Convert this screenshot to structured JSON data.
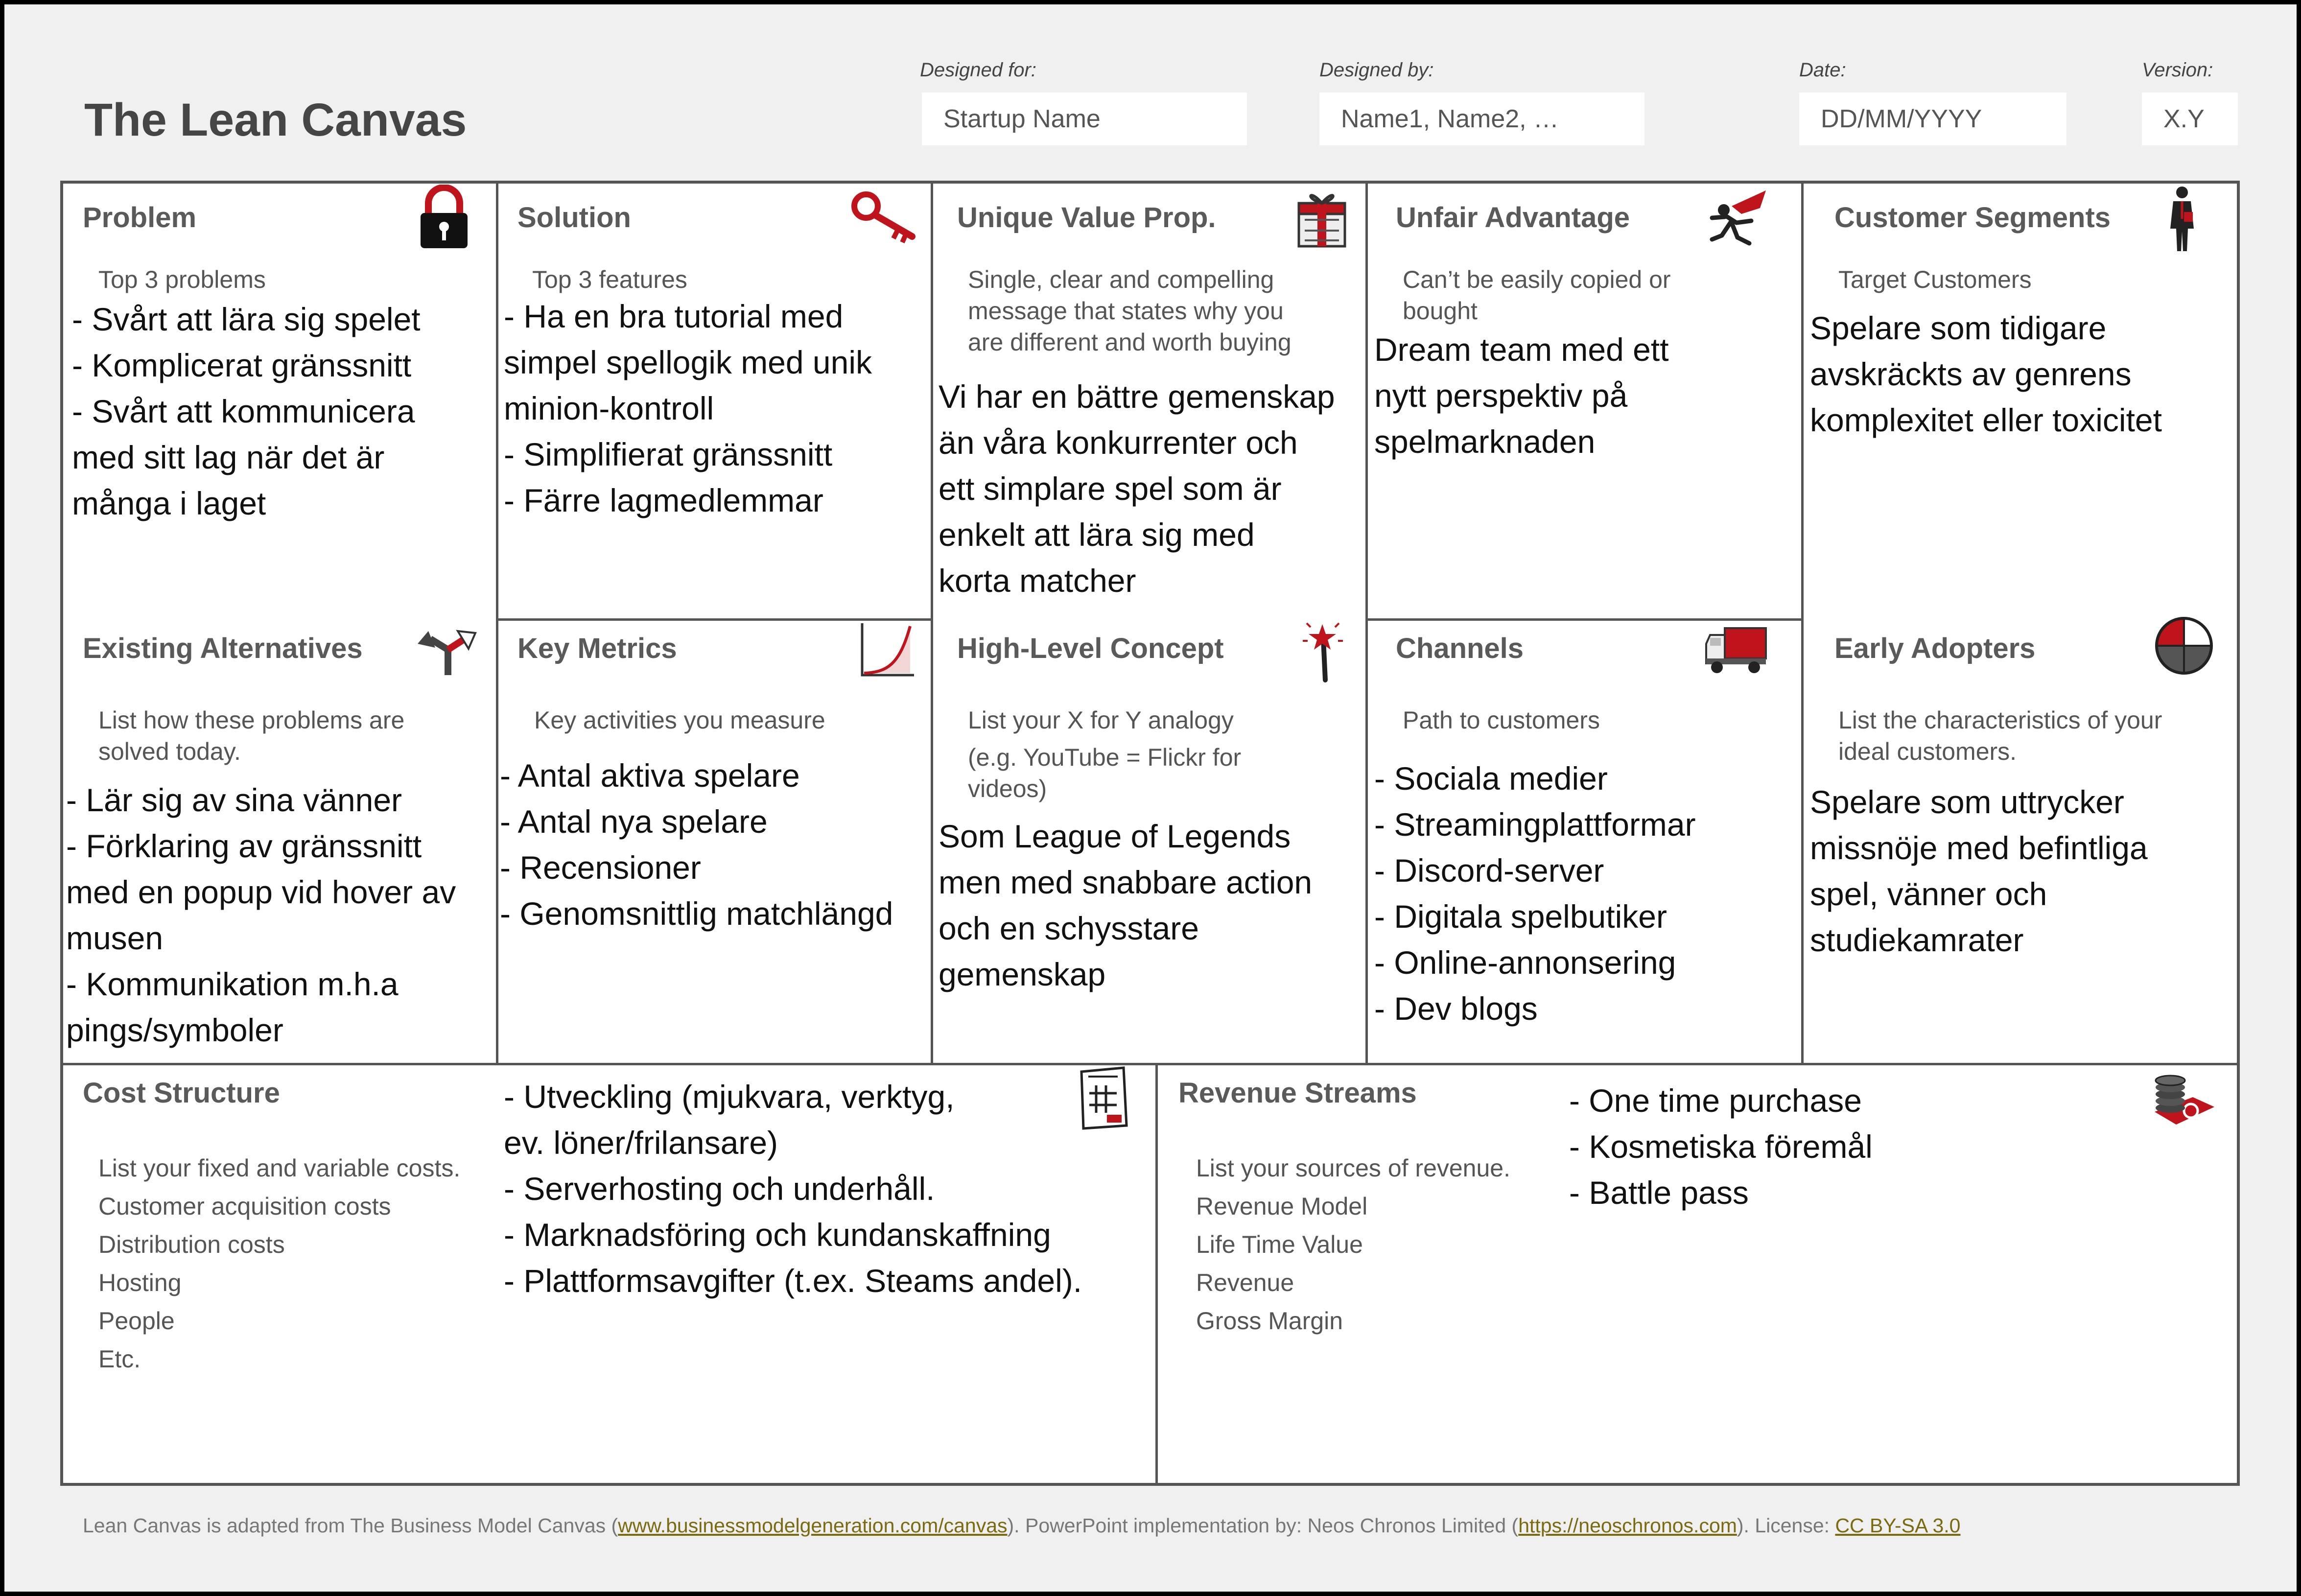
{
  "header": {
    "title": "The Lean Canvas",
    "designed_for_label": "Designed for:",
    "designed_for_value": "Startup Name",
    "designed_by_label": "Designed by:",
    "designed_by_value": "Name1, Name2, …",
    "date_label": "Date:",
    "date_value": "DD/MM/YYYY",
    "version_label": "Version:",
    "version_value": "X.Y"
  },
  "problem": {
    "title": "Problem",
    "icon": "padlock-icon",
    "hint": [
      "Top 3 problems"
    ],
    "lines": [
      "- Svårt att lära sig spelet",
      "- Komplicerat gränssnitt",
      "- Svårt att kommunicera",
      "med sitt lag när det är",
      "många i laget"
    ]
  },
  "solution": {
    "title": "Solution",
    "icon": "key-icon",
    "hint": [
      "Top 3 features"
    ],
    "lines": [
      "- Ha en bra tutorial med",
      "simpel spellogik med unik",
      "minion-kontroll",
      "- Simplifierat gränssnitt",
      "- Färre lagmedlemmar"
    ]
  },
  "uvp": {
    "title": "Unique Value Prop.",
    "icon": "gift-icon",
    "hint": [
      "Single, clear and compelling",
      "message that states why you",
      "are different and worth buying"
    ],
    "lines": [
      "Vi har en bättre gemenskap",
      "än våra konkurrenter och",
      "ett simplare spel som är",
      "enkelt att lära sig med",
      "korta matcher"
    ]
  },
  "unfair": {
    "title": "Unfair Advantage",
    "icon": "superhero-icon",
    "hint": [
      "Can’t be easily copied or",
      "bought"
    ],
    "lines": [
      "Dream team med ett",
      "nytt perspektiv på",
      "spelmarknaden"
    ]
  },
  "segments": {
    "title": "Customer Segments",
    "icon": "person-icon",
    "hint": [
      "Target Customers"
    ],
    "lines": [
      "Spelare som tidigare",
      "avskräckts av genrens",
      "komplexitet eller toxicitet"
    ]
  },
  "alternatives": {
    "title": "Existing Alternatives",
    "icon": "arrows-icon",
    "hint": [
      "List how these problems are",
      "solved today."
    ],
    "lines": [
      "- Lär sig av sina vänner",
      "- Förklaring av gränssnitt",
      "med en popup vid hover av",
      "musen",
      "- Kommunikation m.h.a",
      "pings/symboler"
    ]
  },
  "metrics": {
    "title": "Key Metrics",
    "icon": "growth-chart-icon",
    "hint": [
      "Key activities you measure"
    ],
    "lines": [
      "- Antal aktiva spelare",
      "- Antal nya spelare",
      "- Recensioner",
      "- Genomsnittlig matchlängd"
    ]
  },
  "concept": {
    "title": "High-Level Concept",
    "icon": "magic-wand-icon",
    "hint": [
      "List your X for Y analogy",
      "(e.g. YouTube = Flickr for",
      "videos)"
    ],
    "lines": [
      "Som League of Legends",
      "men med snabbare action",
      "och en schysstare",
      "gemenskap"
    ]
  },
  "channels": {
    "title": "Channels",
    "icon": "truck-icon",
    "hint": [
      "Path to customers"
    ],
    "lines": [
      "- Sociala medier",
      "- Streamingplattformar",
      "- Discord-server",
      "- Digitala spelbutiker",
      "- Online-annonsering",
      "- Dev blogs"
    ]
  },
  "early": {
    "title": "Early Adopters",
    "icon": "pie-chart-icon",
    "hint": [
      "List the characteristics of your",
      "ideal customers."
    ],
    "lines": [
      "Spelare som uttrycker",
      "missnöje med befintliga",
      "spel, vänner och",
      "studiekamrater"
    ]
  },
  "cost": {
    "title": "Cost Structure",
    "icon": "invoice-icon",
    "hint": [
      "List your fixed and variable costs.",
      "Customer acquisition costs",
      "Distribution costs",
      "Hosting",
      "People",
      "Etc."
    ],
    "lines": [
      "- Utveckling (mjukvara, verktyg,",
      "ev. löner/frilansare)",
      "- Serverhosting och underhåll.",
      "- Marknadsföring och kundanskaffning",
      "- Plattformsavgifter (t.ex. Steams andel)."
    ]
  },
  "revenue": {
    "title": "Revenue Streams",
    "icon": "coins-icon",
    "hint": [
      "List your sources of revenue.",
      "Revenue Model",
      "Life Time Value",
      "Revenue",
      "Gross Margin"
    ],
    "lines": [
      "- One time purchase",
      "- Kosmetiska föremål",
      "- Battle pass"
    ]
  },
  "footer": {
    "text1": "Lean Canvas is adapted from The Business Model Canvas (",
    "link1": "www.businessmodelgeneration.com/canvas",
    "text2": "). PowerPoint implementation by: Neos Chronos Limited (",
    "link2": "https://neoschronos.com",
    "text3": "). License: ",
    "link3": "CC BY-SA 3.0"
  },
  "colors": {
    "accent_red": "#c0141c",
    "border": "#555555",
    "background": "#f0f0f0"
  }
}
